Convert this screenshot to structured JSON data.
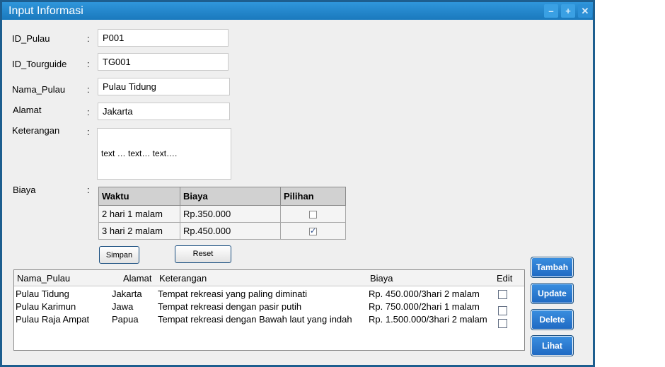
{
  "window": {
    "title": "Input Informasi",
    "controls": {
      "minimize": "–",
      "maximize": "+",
      "close": "✕"
    }
  },
  "form": {
    "colon": ":",
    "id_pulau": {
      "label": "ID_Pulau",
      "value": "P001"
    },
    "id_tourguide": {
      "label": "ID_Tourguide",
      "value": "TG001"
    },
    "nama_pulau": {
      "label": "Nama_Pulau",
      "value": "Pulau Tidung"
    },
    "alamat": {
      "label": "Alamat",
      "value": "Jakarta"
    },
    "keterangan": {
      "label": "Keterangan",
      "value": "text … text… text…."
    },
    "biaya": {
      "label": "Biaya",
      "headers": [
        "Waktu",
        "Biaya",
        "Pilihan"
      ],
      "rows": [
        {
          "waktu": "2 hari 1 malam",
          "biaya": "Rp.350.000",
          "pilihan": false
        },
        {
          "waktu": "3 hari 2 malam",
          "biaya": "Rp.450.000",
          "pilihan": true
        }
      ]
    },
    "simpan_label": "Simpan",
    "reset_label": "Reset"
  },
  "list": {
    "headers": [
      "Nama_Pulau",
      "Alamat",
      "Keterangan",
      "Biaya",
      "Edit"
    ],
    "rows": [
      {
        "nama": "Pulau Tidung",
        "alamat": "Jakarta",
        "keterangan": "Tempat rekreasi yang paling diminati",
        "biaya": "Rp. 450.000/3hari 2 malam",
        "edit": false
      },
      {
        "nama": "Pulau Karimun",
        "alamat": "Jawa",
        "keterangan": "Tempat rekreasi dengan pasir putih",
        "biaya": "Rp. 750.000/2hari 1 malam",
        "edit": false
      },
      {
        "nama": "Pulau Raja Ampat",
        "alamat": "Papua",
        "keterangan": "Tempat rekreasi dengan Bawah laut yang indah",
        "biaya": "Rp. 1.500.000/3hari 2 malam",
        "edit": false
      }
    ]
  },
  "actions": {
    "tambah": "Tambah",
    "update": "Update",
    "delete": "Delete",
    "lihat": "Lihat"
  },
  "colors": {
    "titlebar": "#1a79bd",
    "frame": "#1d5e8f",
    "action_button": "#2a7fd6"
  }
}
